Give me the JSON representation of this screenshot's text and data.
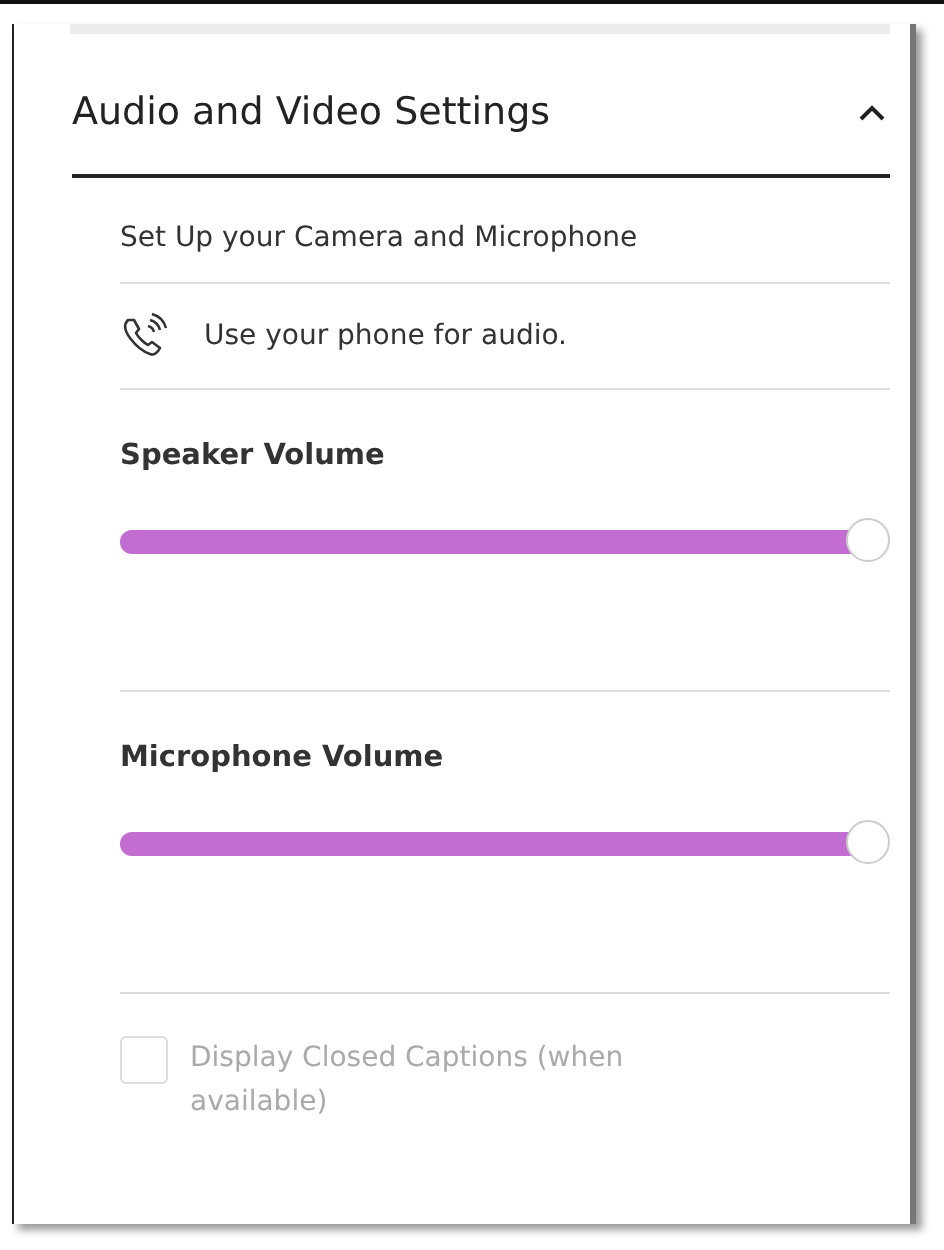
{
  "section": {
    "title": "Audio and Video Settings",
    "expanded": true
  },
  "setup_link": "Set Up your Camera and Microphone",
  "phone_audio": "Use your phone for audio.",
  "sliders": [
    {
      "label": "Speaker Volume",
      "level": 1.0
    },
    {
      "label": "Microphone Volume",
      "level": 1.0
    }
  ],
  "captions": {
    "label": "Display Closed Captions (when available)",
    "checked": false,
    "disabled": true
  }
}
